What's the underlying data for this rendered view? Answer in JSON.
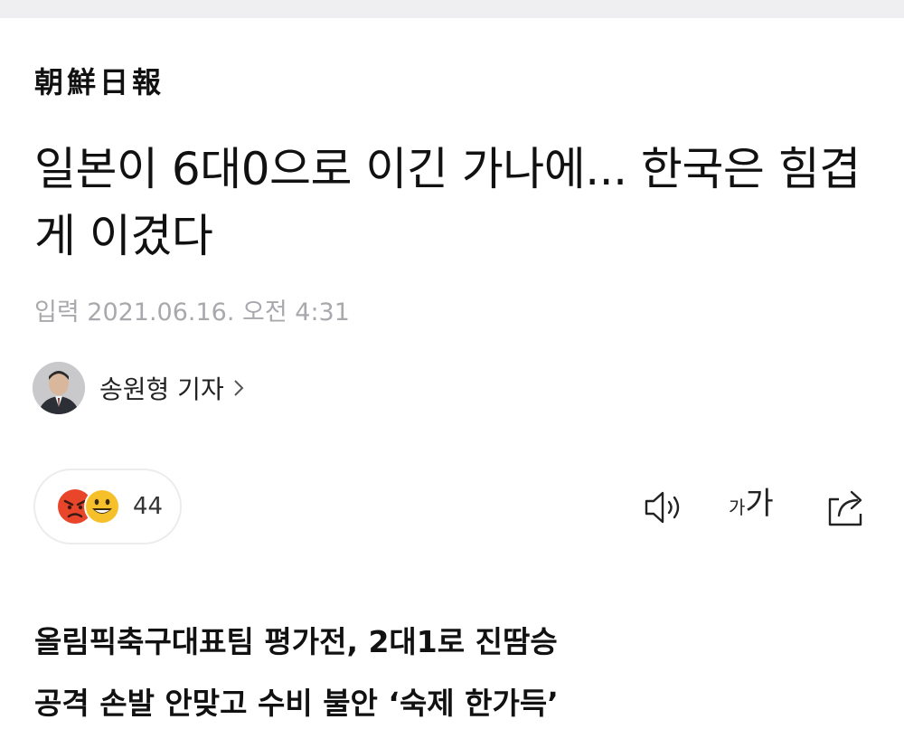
{
  "masthead": {
    "logo_text": "朝鮮日報"
  },
  "article": {
    "headline": "일본이 6대0으로 이긴 가나에... 한국은 힘겹게 이겼다",
    "published": "입력 2021.06.16. 오전 4:31",
    "reporter": "송원형 기자",
    "reactions": {
      "count": "44",
      "emojis": [
        "angry-face",
        "grinning-face"
      ]
    },
    "tools": {
      "listen_icon": "speaker-icon",
      "font_small": "가",
      "font_big": "가",
      "share_icon": "share-icon"
    },
    "subheads": [
      "올림픽축구대표팀 평가전, 2대1로 진땀승",
      "공격 손발 안맞고 수비 불안 ‘숙제 한가득’"
    ]
  },
  "colors": {
    "top_bar": "#efeff1",
    "date_gray": "#a9a9ad",
    "angry_red": "#e8452b",
    "smile_yellow": "#f6c02a"
  }
}
